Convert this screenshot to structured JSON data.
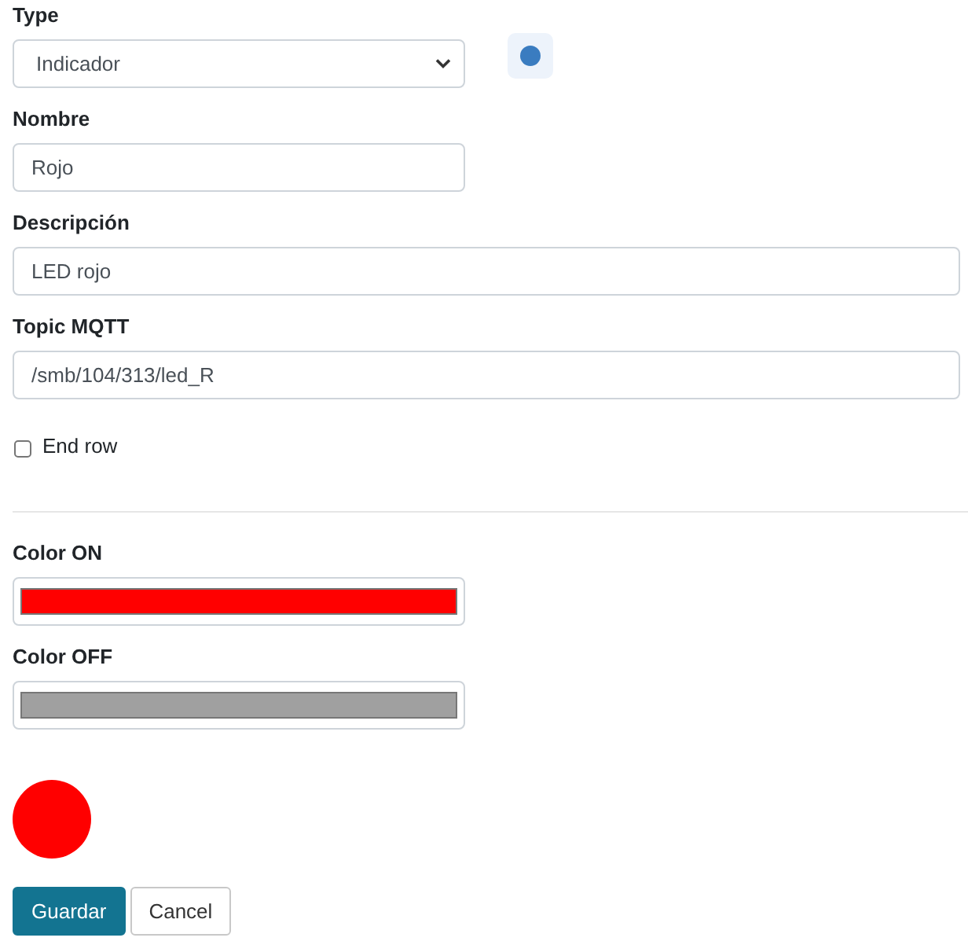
{
  "type_field": {
    "label": "Type",
    "value": "Indicador"
  },
  "name_field": {
    "label": "Nombre",
    "value": "Rojo"
  },
  "description_field": {
    "label": "Descripción",
    "value": "LED rojo"
  },
  "topic_field": {
    "label": "Topic MQTT",
    "value": "/smb/104/313/led_R"
  },
  "end_row": {
    "label": "End row",
    "checked": false
  },
  "color_on": {
    "label": "Color ON",
    "color": "#ff0000"
  },
  "color_off": {
    "label": "Color OFF",
    "color": "#a0a0a0"
  },
  "preview": {
    "on": true
  },
  "buttons": [
    {
      "label": "Guardar",
      "kind": "primary"
    },
    {
      "label": "Cancel",
      "kind": "secondary"
    }
  ]
}
